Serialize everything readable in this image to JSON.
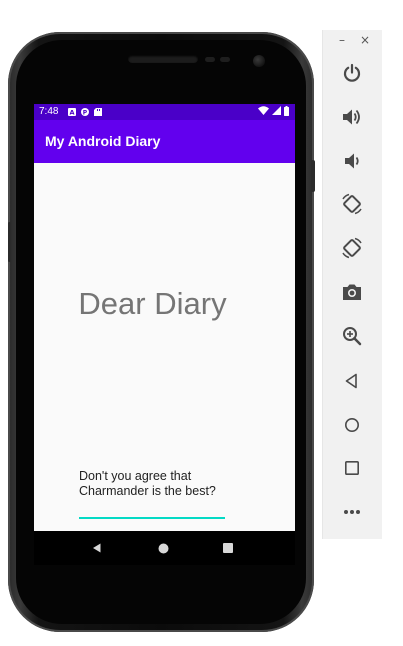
{
  "status_bar": {
    "time": "7:48",
    "notification_icons": [
      "a-notification-icon",
      "p-notification-icon",
      "sd-card-icon"
    ],
    "status_icons": [
      "wifi-icon",
      "signal-icon",
      "battery-icon"
    ],
    "color": "#4a00c8"
  },
  "app_bar": {
    "title": "My Android Diary",
    "color": "#6200ee"
  },
  "main": {
    "heading": "Dear Diary",
    "entry_text": "Don't you agree that Charmander is the best?",
    "underline_color": "#03dac5"
  },
  "nav_bar": {
    "buttons": [
      "back-icon",
      "home-icon",
      "recents-icon"
    ]
  },
  "emulator_panel": {
    "window_controls": {
      "minimize": "–",
      "close": "×"
    },
    "buttons": [
      "power-icon",
      "volume-up-icon",
      "volume-down-icon",
      "rotate-left-icon",
      "rotate-right-icon",
      "camera-icon",
      "zoom-icon",
      "back-icon",
      "home-icon",
      "overview-icon",
      "more-icon"
    ]
  }
}
